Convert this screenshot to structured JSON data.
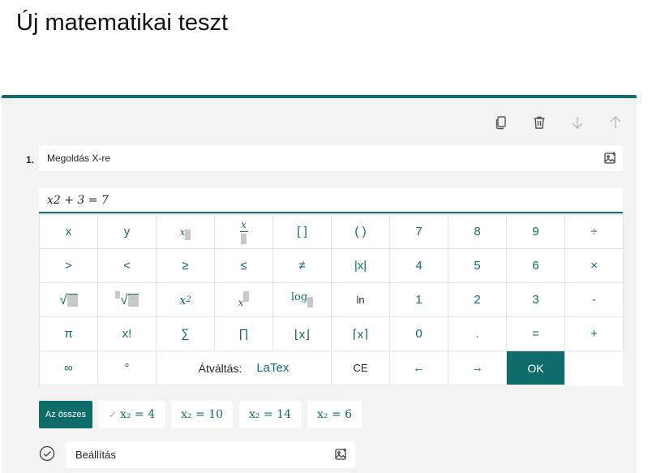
{
  "page": {
    "title": "Új matematikai teszt"
  },
  "question": {
    "number": "1.",
    "title": "Megoldás X-re",
    "equation": "x2  + 3 = 7"
  },
  "keypad": {
    "row1": [
      "x",
      "y",
      "[ ]",
      "( )",
      "7",
      "8",
      "9",
      "÷"
    ],
    "frac_num": "x",
    "row2": [
      ">",
      "<",
      "≥",
      "≤",
      "≠",
      "|x|",
      "4",
      "5",
      "6",
      "×"
    ],
    "row3": {
      "sqrt": "√",
      "pow2": "x",
      "pow2_sup": "2",
      "powx": "x",
      "log": "log",
      "ln": "ln",
      "d1": "1",
      "d2": "2",
      "d3": "3",
      "minus": "-"
    },
    "row4": [
      "π",
      "x!",
      "∑",
      "∏",
      "⌊x⌋",
      "⌈x⌉",
      "0",
      ".",
      "=",
      "+"
    ],
    "row5": {
      "inf": "∞",
      "deg": "°",
      "switch_label": "Átváltás:",
      "switch_value": "LaTex",
      "ce": "CE",
      "left": "←",
      "right": "→",
      "ok": "OK"
    }
  },
  "answers": {
    "all_label": "Az összes",
    "items": [
      {
        "text": "x₂ = 4",
        "checked": true
      },
      {
        "text": "x₂ = 10"
      },
      {
        "text": "x₂ = 14"
      },
      {
        "text": "x₂ = 6"
      }
    ]
  },
  "settings": {
    "label": "Beállítás"
  },
  "colors": {
    "accent": "#0f6c6b",
    "card_bg": "#f3f3f3"
  }
}
